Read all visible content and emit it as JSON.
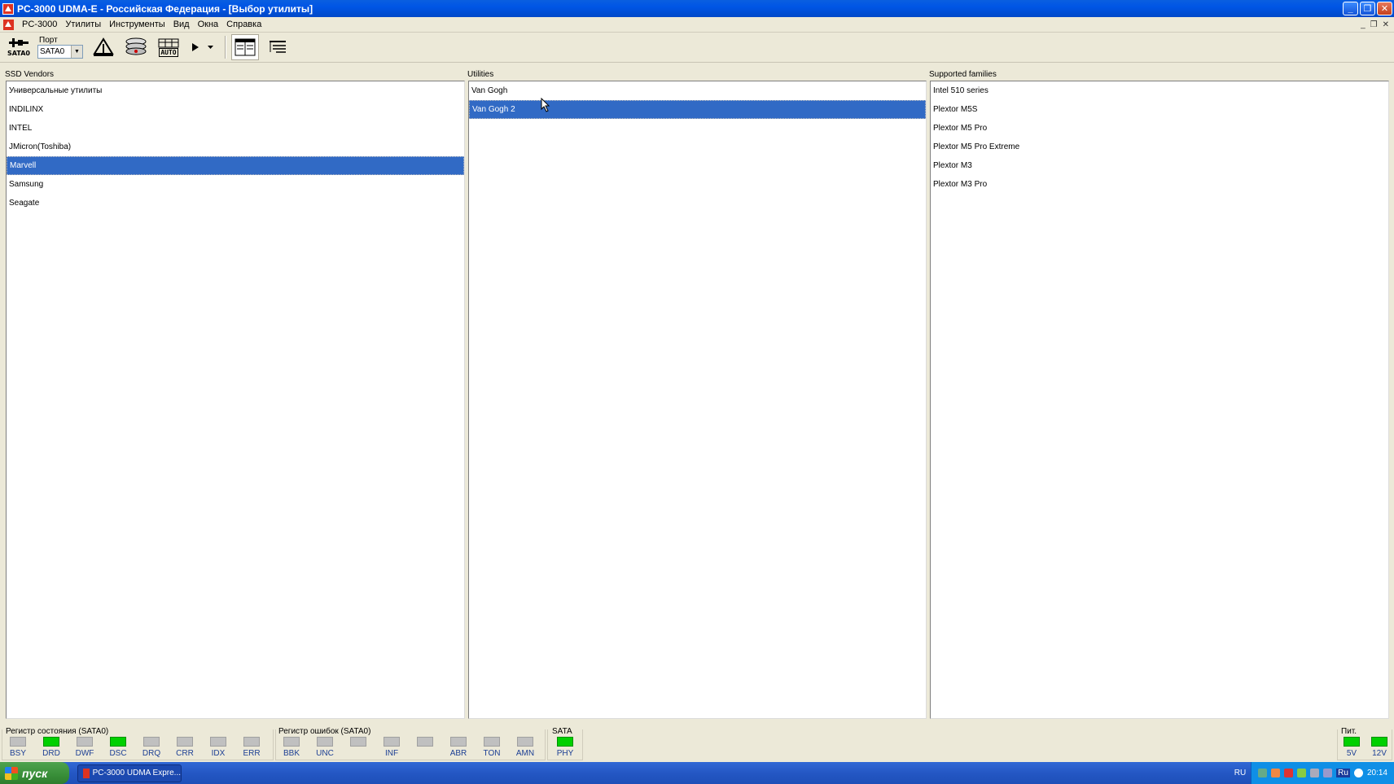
{
  "window": {
    "title": "PC-3000 UDMA-E - Российская Федерация - [Выбор утилиты]",
    "minimize": "_",
    "restore": "❐",
    "close": "✕"
  },
  "menu": {
    "items": [
      "PC-3000",
      "Утилиты",
      "Инструменты",
      "Вид",
      "Окна",
      "Справка"
    ],
    "mdi_min": "_",
    "mdi_restore": "❐",
    "mdi_close": "✕"
  },
  "toolbar": {
    "sata_label": "SATA0",
    "port_label": "Порт",
    "port_value": "SATA0",
    "auto_label": "AUTO"
  },
  "panels": {
    "vendors": {
      "label": "SSD Vendors",
      "items": [
        "Универсальные утилиты",
        "INDILINX",
        "INTEL",
        "JMicron(Toshiba)",
        "Marvell",
        "Samsung",
        "Seagate"
      ],
      "selected_index": 4
    },
    "utilities": {
      "label": "Utilities",
      "items": [
        "Van Gogh",
        "Van Gogh 2"
      ],
      "selected_index": 1
    },
    "families": {
      "label": "Supported families",
      "items": [
        "Intel 510 series",
        "Plextor M5S",
        "Plextor M5 Pro",
        "Plextor M5 Pro Extreme",
        "Plextor M3",
        "Plextor M3 Pro"
      ]
    }
  },
  "status": {
    "state_register": {
      "title": "Регистр состояния (SATA0)",
      "indicators": [
        {
          "label": "BSY",
          "on": false
        },
        {
          "label": "DRD",
          "on": true
        },
        {
          "label": "DWF",
          "on": false
        },
        {
          "label": "DSC",
          "on": true
        },
        {
          "label": "DRQ",
          "on": false
        },
        {
          "label": "CRR",
          "on": false
        },
        {
          "label": "IDX",
          "on": false
        },
        {
          "label": "ERR",
          "on": false
        }
      ]
    },
    "error_register": {
      "title": "Регистр ошибок  (SATA0)",
      "indicators": [
        {
          "label": "BBK",
          "on": false
        },
        {
          "label": "UNC",
          "on": false
        },
        {
          "label": "",
          "on": false
        },
        {
          "label": "INF",
          "on": false
        },
        {
          "label": "",
          "on": false
        },
        {
          "label": "ABR",
          "on": false
        },
        {
          "label": "TON",
          "on": false
        },
        {
          "label": "AMN",
          "on": false
        }
      ]
    },
    "sata": {
      "title": "SATA",
      "indicators": [
        {
          "label": "PHY",
          "on": true
        }
      ]
    },
    "power": {
      "title": "Пит.",
      "indicators": [
        {
          "label": "5V",
          "on": true
        },
        {
          "label": "12V",
          "on": true
        }
      ]
    }
  },
  "taskbar": {
    "start_label": "пуск",
    "task_label": "PC-3000 UDMA Expre...",
    "lang": "RU",
    "tray_lang": "Ru",
    "clock": "20:14"
  },
  "colors": {
    "selection": "#316ac5",
    "indicator_on": "#00d000",
    "indicator_off": "#c0c0c0"
  }
}
